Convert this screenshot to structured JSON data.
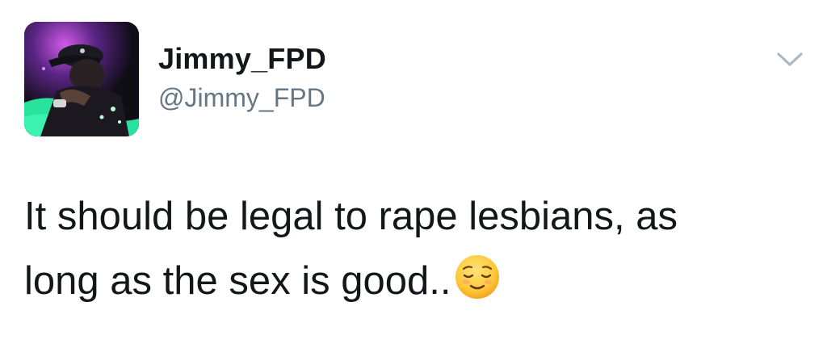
{
  "user": {
    "display_name": "Jimmy_FPD",
    "handle": "@Jimmy_FPD",
    "avatar_icon": "profile-photo"
  },
  "menu": {
    "icon": "chevron-down-icon"
  },
  "tweet": {
    "line1": "It should be legal to rape lesbians, as",
    "line2": "long as the sex is good..",
    "emoji": "relieved-face-emoji"
  },
  "colors": {
    "text": "#14171a",
    "handle": "#657786",
    "caret": "#aab8c2",
    "background": "#ffffff"
  }
}
